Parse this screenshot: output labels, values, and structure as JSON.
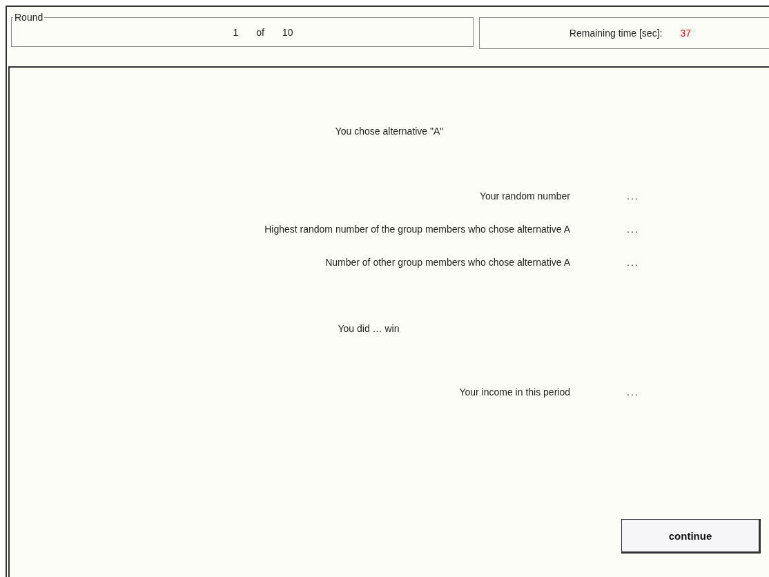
{
  "round": {
    "legend": "Round",
    "current": "1",
    "of": "of",
    "total": "10"
  },
  "timer": {
    "label": "Remaining time [sec]:",
    "value": "37"
  },
  "choice_text": "You chose alternative \"A\"",
  "results": [
    {
      "label": "Your random number",
      "value": "..."
    },
    {
      "label": "Highest random number of the group members who chose alternative A",
      "value": "..."
    },
    {
      "label": "Number of other group members who chose alternative A",
      "value": "..."
    }
  ],
  "outcome": {
    "text": "You did … win"
  },
  "income": {
    "label": "Your income in this period",
    "value": "..."
  },
  "buttons": [
    {
      "label": "continue"
    }
  ]
}
